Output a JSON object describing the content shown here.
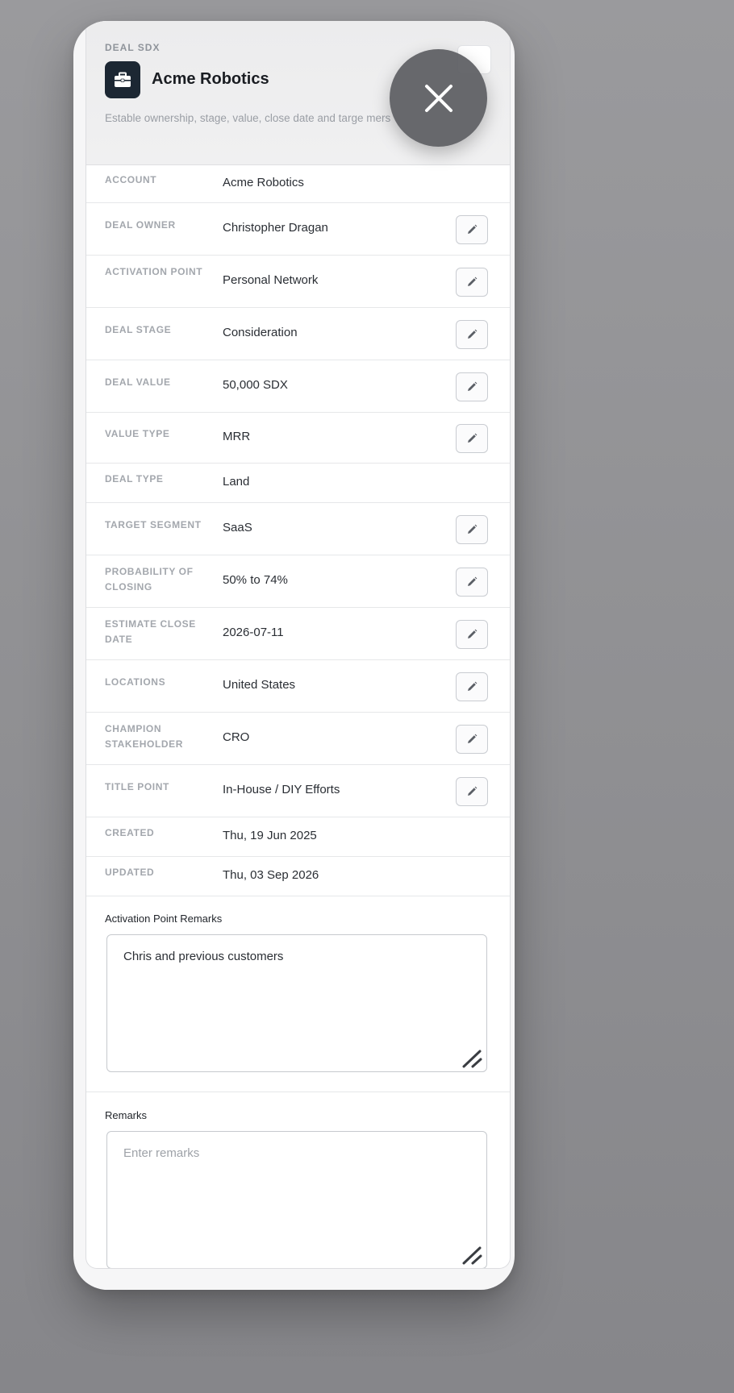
{
  "header": {
    "eyebrow": "DEAL SDX",
    "title": "Acme Robotics",
    "description": "Estable ownership, stage, value, close date and targe mers",
    "icon": "briefcase-icon"
  },
  "fields": [
    {
      "label": "ACCOUNT",
      "value": "Acme Robotics",
      "editable": false
    },
    {
      "label": "DEAL OWNER",
      "value": "Christopher Dragan",
      "editable": true
    },
    {
      "label": "ACTIVATION POINT",
      "value": "Personal Network",
      "editable": true
    },
    {
      "label": "DEAL STAGE",
      "value": "Consideration",
      "editable": true
    },
    {
      "label": "DEAL VALUE",
      "value": "50,000 SDX",
      "editable": true
    },
    {
      "label": "VALUE TYPE",
      "value": "MRR",
      "editable": true
    },
    {
      "label": "DEAL TYPE",
      "value": "Land",
      "editable": false
    },
    {
      "label": "TARGET SEGMENT",
      "value": "SaaS",
      "editable": true
    },
    {
      "label": "PROBABILITY OF CLOSING",
      "value": "50% to 74%",
      "editable": true
    },
    {
      "label": "ESTIMATE CLOSE DATE",
      "value": "2026-07-11",
      "editable": true
    },
    {
      "label": "LOCATIONS",
      "value": "United States",
      "editable": true
    },
    {
      "label": "CHAMPION STAKEHOLDER",
      "value": "CRO",
      "editable": true
    },
    {
      "label": "TITLE POINT",
      "value": "In-House / DIY Efforts",
      "editable": true
    },
    {
      "label": "CREATED",
      "value": "Thu, 19 Jun 2025",
      "editable": false
    },
    {
      "label": "UPDATED",
      "value": "Thu, 03 Sep 2026",
      "editable": false
    }
  ],
  "activation_remarks": {
    "label": "Activation Point Remarks",
    "value": "Chris and previous customers"
  },
  "remarks": {
    "label": "Remarks",
    "placeholder": "Enter remarks",
    "value": ""
  },
  "icons": {
    "edit": "pencil-icon",
    "close": "close-icon",
    "resize": "resize-handle-icon"
  }
}
